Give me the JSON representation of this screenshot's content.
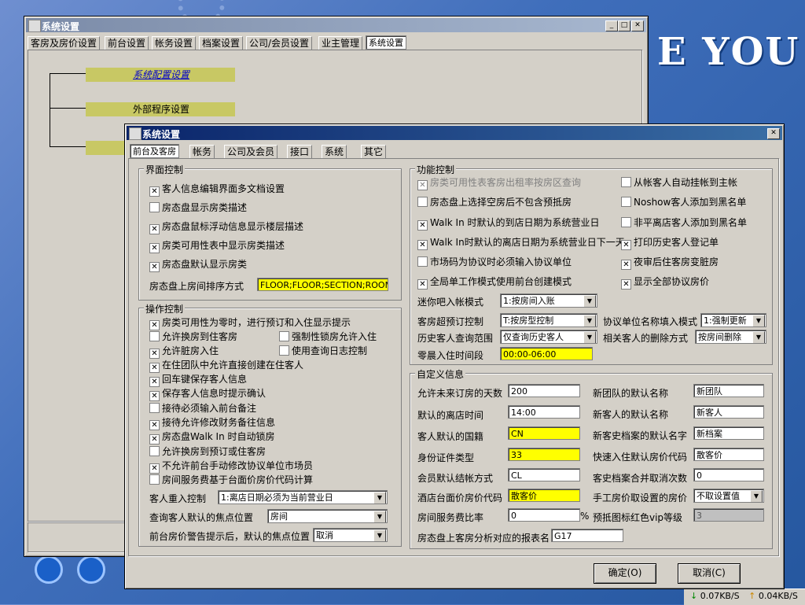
{
  "desktop": {
    "logo": "E YOU",
    "speed_down": "0.07KB/S",
    "speed_up": "0.04KB/S"
  },
  "back_window": {
    "title": "系统设置",
    "tabs": [
      "客房及房价设置",
      "前台设置",
      "帐务设置",
      "档案设置",
      "公司/会员设置",
      "业主管理",
      "系统设置"
    ],
    "tree": [
      "系统配置设置",
      "外部程序设置"
    ]
  },
  "dialog": {
    "title": "系统设置",
    "tabs": [
      "前台及客房",
      "帐务",
      "公司及会员",
      "接口",
      "系统",
      "其它"
    ],
    "ui_control": {
      "label": "界面控制",
      "items": [
        {
          "text": "客人信息编辑界面多文档设置",
          "checked": true
        },
        {
          "text": "房态盘显示房类描述",
          "checked": false
        },
        {
          "text": "房态盘鼠标浮动信息显示楼层描述",
          "checked": true
        },
        {
          "text": "房类可用性表中显示房类描述",
          "checked": true
        },
        {
          "text": "房态盘默认显示房类",
          "checked": true
        }
      ],
      "sort_label": "房态盘上房间排序方式",
      "sort_value": "FLOOR;FLOOR;SECTION;ROOMNO"
    },
    "op_control": {
      "label": "操作控制",
      "items": [
        {
          "text": "房类可用性为零时，进行预订和入住显示提示",
          "checked": true
        },
        {
          "text": "允许换房到住客房",
          "checked": false
        },
        {
          "text": "强制性锁房允许入住",
          "checked": false
        },
        {
          "text": "允许脏房入住",
          "checked": true
        },
        {
          "text": "使用查询日志控制",
          "checked": false
        },
        {
          "text": "在住团队中允许直接创建在住客人",
          "checked": true
        },
        {
          "text": "回车键保存客人信息",
          "checked": true
        },
        {
          "text": "保存客人信息时提示确认",
          "checked": true
        },
        {
          "text": "接待必须输入前台备注",
          "checked": false
        },
        {
          "text": "接待允许修改财务备往信息",
          "checked": true
        },
        {
          "text": "房态盘Walk In 时自动锁房",
          "checked": true
        },
        {
          "text": "允许换房到预订或住客房",
          "checked": false
        },
        {
          "text": "不允许前台手动修改协议单位市场员",
          "checked": true
        },
        {
          "text": "房间服务费基于台面价房价代码计算",
          "checked": false
        }
      ],
      "rows": [
        {
          "label": "客人重入控制",
          "value": "1:离店日期必须为当前营业日"
        },
        {
          "label": "查询客人默认的焦点位置",
          "value": "房间"
        },
        {
          "label": "前台房价警告提示后，默认的焦点位置",
          "value": "取消"
        }
      ]
    },
    "func_control": {
      "label": "功能控制",
      "left_items": [
        {
          "text": "房类可用性表客房出租率按房区查询",
          "checked": true,
          "disabled": true
        },
        {
          "text": "房态盘上选择空房后不包含预抵房",
          "checked": false
        },
        {
          "text": "Walk In 时默认的到店日期为系统营业日",
          "checked": true
        },
        {
          "text": "Walk In时默认的离店日期为系统营业日下一天",
          "checked": true
        },
        {
          "text": "市场码为协议时必须输入协议单位",
          "checked": false
        },
        {
          "text": "全局单工作模式使用前台创建模式",
          "checked": true
        }
      ],
      "right_items": [
        {
          "text": "从帐客人自动挂帐到主帐",
          "checked": false
        },
        {
          "text": "Noshow客人添加到黑名单",
          "checked": false
        },
        {
          "text": "非平离店客人添加到黑名单",
          "checked": false
        },
        {
          "text": "打印历史客人登记单",
          "checked": true
        },
        {
          "text": "夜审后住客房变脏房",
          "checked": true
        },
        {
          "text": "显示全部协议房价",
          "checked": true
        }
      ],
      "minibar_label": "迷你吧入帐模式",
      "minibar_value": "1:按房间入账",
      "overbook_label": "客房超预订控制",
      "overbook_value": "T:按房型控制",
      "agreement_label": "协议单位名称填入模式",
      "agreement_value": "1:强制更新",
      "history_label": "历史客人查询范围",
      "history_value": "仅查询历史客人",
      "related_label": "相关客人的删除方式",
      "related_value": "按房间删除",
      "early_label": "零晨入住时间段",
      "early_value": "00:00-06:00"
    },
    "custom_info": {
      "label": "自定义信息",
      "rows": [
        {
          "l": "允许未来订房的天数",
          "v": "200",
          "r": "新团队的默认名称",
          "rv": "新团队"
        },
        {
          "l": "默认的离店时间",
          "v": "14:00",
          "r": "新客人的默认名称",
          "rv": "新客人"
        },
        {
          "l": "客人默认的国籍",
          "v": "CN",
          "r": "新客史档案的默认名字",
          "rv": "新档案"
        },
        {
          "l": "身份证件类型",
          "v": "33",
          "r": "快速入住默认房价代码",
          "rv": "散客价"
        },
        {
          "l": "会员默认结帐方式",
          "v": "CL",
          "r": "客史档案合并取消次数",
          "rv": "0"
        },
        {
          "l": "酒店台面价房价代码",
          "v": "散客价",
          "r": "手工房价取设置的房价",
          "rv": "不取设置值"
        },
        {
          "l": "房间服务费比率",
          "v": "0",
          "r": "预抵图标红色vip等级",
          "rv": "3"
        }
      ],
      "percent": "%",
      "report_label": "房态盘上客房分析对应的报表名",
      "report_value": "G17"
    },
    "ok_label": "确定(O)",
    "cancel_label": "取消(C)"
  }
}
